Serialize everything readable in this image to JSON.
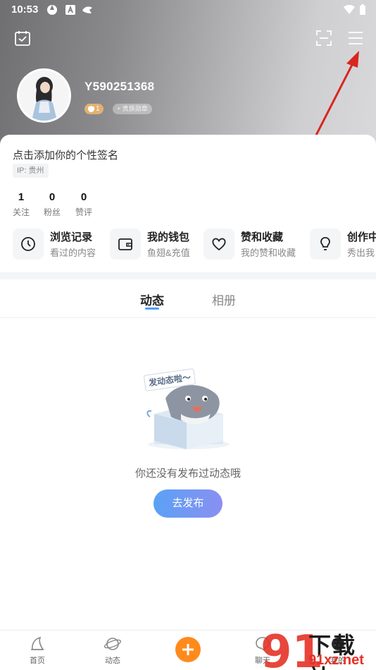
{
  "status_bar": {
    "time": "10:53"
  },
  "profile": {
    "username": "Y590251368",
    "level": "1",
    "medal_label": "+ 贵族勋章",
    "signature_placeholder": "点击添加你的个性签名",
    "ip_location": "IP: 贵州"
  },
  "stats": [
    {
      "value": "1",
      "label": "关注"
    },
    {
      "value": "0",
      "label": "粉丝"
    },
    {
      "value": "0",
      "label": "赞评"
    }
  ],
  "shortcuts": [
    {
      "title": "浏览记录",
      "subtitle": "看过的内容",
      "icon": "clock-icon"
    },
    {
      "title": "我的钱包",
      "subtitle": "鱼翅&充值",
      "icon": "wallet-icon"
    },
    {
      "title": "赞和收藏",
      "subtitle": "我的赞和收藏",
      "icon": "heart-icon"
    },
    {
      "title": "创作中",
      "subtitle": "秀出我",
      "icon": "bulb-icon"
    }
  ],
  "tabs": [
    {
      "label": "动态",
      "active": true
    },
    {
      "label": "相册",
      "active": false
    }
  ],
  "empty_state": {
    "bubble_text": "发动态啦～",
    "message": "你还没有发布过动态哦",
    "button_label": "去发布"
  },
  "tab_bar": {
    "items": [
      {
        "label": "首页",
        "icon": "home-icon"
      },
      {
        "label": "动态",
        "icon": "planet-icon"
      },
      {
        "label": "",
        "icon": "plus-icon"
      },
      {
        "label": "聊天",
        "icon": "chat-icon"
      },
      {
        "label": "我的",
        "icon": "profile-icon"
      }
    ]
  },
  "watermark": {
    "line1": "下载站",
    "line2": "91xz.net",
    "digits": "91"
  },
  "colors": {
    "accent": "#4aa0f8",
    "publish_start": "#5aa2f5",
    "publish_end": "#8a8ff2",
    "plus": "#ff8a1c",
    "arrow": "#d8261f"
  }
}
